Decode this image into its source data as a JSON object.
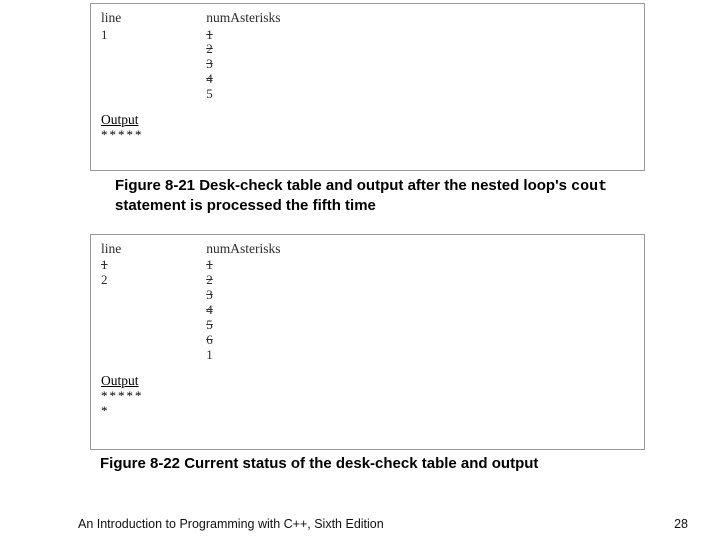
{
  "table1": {
    "col1_header": "line",
    "col2_header": "numAsterisks",
    "col1_vals": [
      "1"
    ],
    "col1_strike": [
      false
    ],
    "col2_vals": [
      "1",
      "2",
      "3",
      "4",
      "5"
    ],
    "col2_strike": [
      true,
      true,
      true,
      true,
      false
    ],
    "output_label": "Output",
    "output_lines": [
      "*****"
    ]
  },
  "caption1": {
    "prefix": "Figure 8-21 Desk-check table and output after the nested loop's ",
    "code": "cout",
    "suffix": " statement is processed the fifth time"
  },
  "table2": {
    "col1_header": "line",
    "col2_header": "numAsterisks",
    "col1_vals": [
      "1",
      "2"
    ],
    "col1_strike": [
      true,
      false
    ],
    "col2_vals": [
      "1",
      "2",
      "3",
      "4",
      "5",
      "6",
      "1"
    ],
    "col2_strike": [
      true,
      true,
      true,
      true,
      true,
      true,
      false
    ],
    "output_label": "Output",
    "output_lines": [
      "*****",
      "*"
    ]
  },
  "caption2": "Figure 8-22 Current status of the desk-check table and output",
  "footer": {
    "left": "An Introduction to Programming with C++, Sixth Edition",
    "right": "28"
  }
}
